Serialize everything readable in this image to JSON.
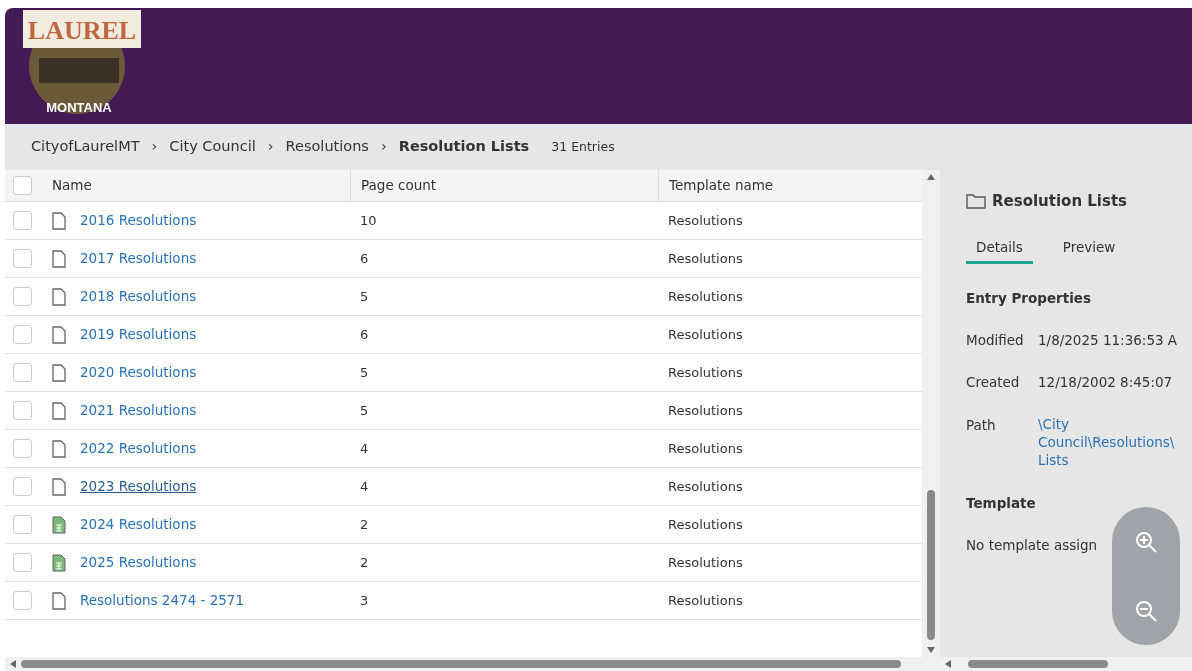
{
  "logo": {
    "top_text": "LAUREL",
    "bottom_text": "MONTANA"
  },
  "breadcrumb": {
    "items": [
      {
        "label": "CityofLaurelMT",
        "current": false
      },
      {
        "label": "City Council",
        "current": false
      },
      {
        "label": "Resolutions",
        "current": false
      },
      {
        "label": "Resolution Lists",
        "current": true
      }
    ],
    "separator": "›",
    "count": "31 Entries"
  },
  "table": {
    "columns": [
      "Name",
      "Page count",
      "Template name"
    ],
    "all_checked": false,
    "rows": [
      {
        "name": "2016 Resolutions",
        "kind": "document",
        "page_count": "10",
        "template": "Resolutions",
        "checked": false
      },
      {
        "name": "2017 Resolutions",
        "kind": "document",
        "page_count": "6",
        "template": "Resolutions",
        "checked": false
      },
      {
        "name": "2018 Resolutions",
        "kind": "document",
        "page_count": "5",
        "template": "Resolutions",
        "checked": false
      },
      {
        "name": "2019 Resolutions",
        "kind": "document",
        "page_count": "6",
        "template": "Resolutions",
        "checked": false
      },
      {
        "name": "2020 Resolutions",
        "kind": "document",
        "page_count": "5",
        "template": "Resolutions",
        "checked": false
      },
      {
        "name": "2021 Resolutions",
        "kind": "document",
        "page_count": "5",
        "template": "Resolutions",
        "checked": false
      },
      {
        "name": "2022 Resolutions",
        "kind": "document",
        "page_count": "4",
        "template": "Resolutions",
        "checked": false
      },
      {
        "name": "2023 Resolutions",
        "kind": "document",
        "page_count": "4",
        "template": "Resolutions",
        "checked": false,
        "hovered": true
      },
      {
        "name": "2024 Resolutions",
        "kind": "spreadsheet",
        "page_count": "2",
        "template": "Resolutions",
        "checked": false
      },
      {
        "name": "2025 Resolutions",
        "kind": "spreadsheet",
        "page_count": "2",
        "template": "Resolutions",
        "checked": false
      },
      {
        "name": "Resolutions 2474 - 2571",
        "kind": "document",
        "page_count": "3",
        "template": "Resolutions",
        "checked": false
      }
    ]
  },
  "details": {
    "title": "Resolution Lists",
    "tabs": [
      {
        "label": "Details",
        "selected": true
      },
      {
        "label": "Preview",
        "selected": false
      }
    ],
    "section_title": "Entry Properties",
    "properties": [
      {
        "label": "Modified",
        "value": "1/8/2025 11:36:53 A",
        "kind": "text"
      },
      {
        "label": "Created",
        "value": "12/18/2002 8:45:07",
        "kind": "text"
      },
      {
        "label": "Path",
        "value": "\\City Council\\Resolutions\\ Lists",
        "kind": "link"
      }
    ],
    "template_title": "Template",
    "template_value": "No template assign"
  }
}
